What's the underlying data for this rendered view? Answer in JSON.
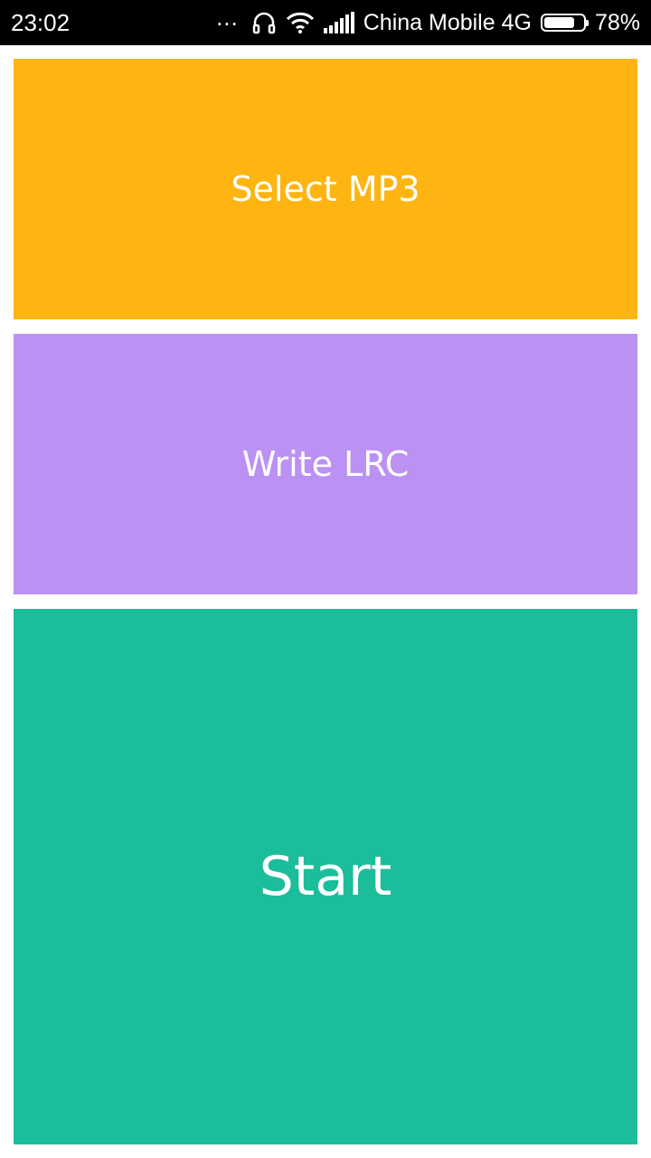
{
  "status_bar": {
    "time": "23:02",
    "dots": "...",
    "carrier": "China Mobile 4G",
    "battery_percent": "78%",
    "battery_level": 0.78,
    "icons": [
      "headphones-icon",
      "wifi-icon",
      "signal-icon",
      "battery-icon"
    ]
  },
  "tiles": [
    {
      "label": "Select MP3",
      "color": "#FEB512"
    },
    {
      "label": "Write LRC",
      "color": "#BB91F4"
    },
    {
      "label": "Start",
      "color": "#1CBD9A"
    }
  ]
}
